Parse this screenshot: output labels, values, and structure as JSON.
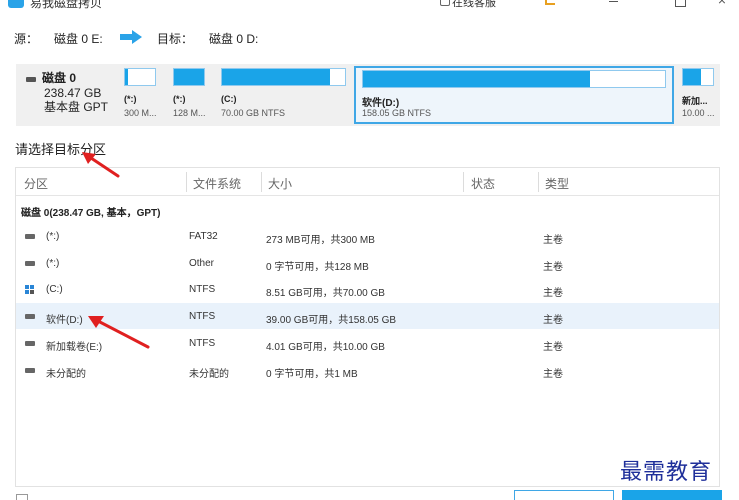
{
  "window": {
    "title": "易我磁盘拷贝",
    "online_help": "在线客服"
  },
  "copy_route": {
    "source_label": "源：",
    "source_value": "磁盘 0 E:",
    "target_label": "目标：",
    "target_value": "磁盘 0 D:"
  },
  "disk": {
    "name": "磁盘 0",
    "size": "238.47 GB",
    "type": "基本盘 GPT",
    "partitions": [
      {
        "name": "(*:)",
        "info": "300 M...",
        "used_fraction": 0.09
      },
      {
        "name": "(*:)",
        "info": "128 M...",
        "used_fraction": 1.0
      },
      {
        "name": "(C:)",
        "info": "70.00 GB NTFS",
        "used_fraction": 0.88
      },
      {
        "name": "软件(D:)",
        "info": "158.05 GB NTFS",
        "used_fraction": 0.75,
        "selected": true
      },
      {
        "name": "新加...",
        "info": "10.00 ...",
        "used_fraction": 0.6
      }
    ]
  },
  "prompt": "请选择目标分区",
  "table": {
    "columns": [
      "分区",
      "文件系统",
      "大小",
      "状态",
      "类型"
    ],
    "group": "磁盘 0(238.47 GB, 基本，GPT)",
    "rows": [
      {
        "partition": "(*:)",
        "fs": "FAT32",
        "size": "273 MB可用，共300 MB",
        "status": "",
        "type": "主卷",
        "icon": "drive-icon"
      },
      {
        "partition": "(*:)",
        "fs": "Other",
        "size": "0 字节可用，共128 MB",
        "status": "",
        "type": "主卷",
        "icon": "drive-icon"
      },
      {
        "partition": "(C:)",
        "fs": "NTFS",
        "size": "8.51 GB可用，共70.00 GB",
        "status": "",
        "type": "主卷",
        "icon": "windows-drive-icon"
      },
      {
        "partition": "软件(D:)",
        "fs": "NTFS",
        "size": "39.00 GB可用，共158.05 GB",
        "status": "",
        "type": "主卷",
        "icon": "drive-icon",
        "selected": true
      },
      {
        "partition": "新加载卷(E:)",
        "fs": "NTFS",
        "size": "4.01 GB可用，共10.00 GB",
        "status": "",
        "type": "主卷",
        "icon": "drive-icon"
      },
      {
        "partition": "未分配的",
        "fs": "未分配的",
        "size": "0 字节可用，共1 MB",
        "status": "",
        "type": "主卷",
        "icon": "drive-icon"
      }
    ]
  },
  "watermark": "最需教育",
  "colors": {
    "accent": "#1aa4e8",
    "selection": "#e9f2fb",
    "annotation_arrow": "#e02020",
    "watermark": "#1f2f9a"
  }
}
